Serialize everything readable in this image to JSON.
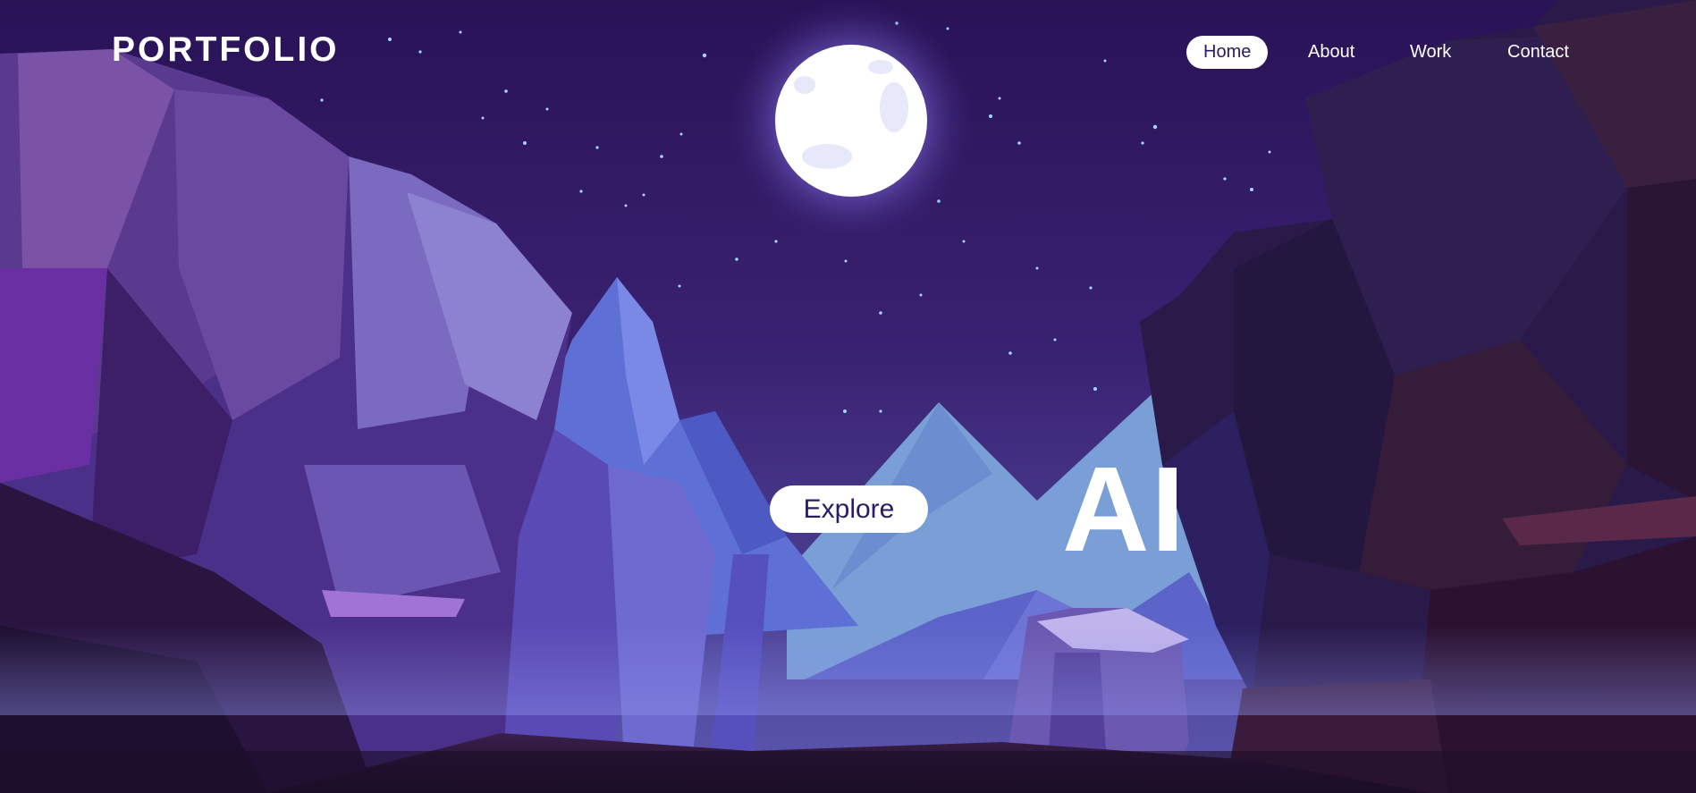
{
  "header": {
    "logo": "PORTFOLIO",
    "nav": [
      {
        "label": "Home",
        "active": true
      },
      {
        "label": "About",
        "active": false
      },
      {
        "label": "Work",
        "active": false
      },
      {
        "label": "Contact",
        "active": false
      }
    ]
  },
  "hero": {
    "cta_label": "Explore",
    "headline_fragment": "AI"
  },
  "colors": {
    "sky_top": "#2b1358",
    "sky_bottom": "#5a4aa6",
    "moon": "#ffffff",
    "nav_active_bg": "#ffffff",
    "nav_active_text": "#2b1a66",
    "mountain_far": "#7a9fd6",
    "mountain_mid": "#6873d6"
  }
}
